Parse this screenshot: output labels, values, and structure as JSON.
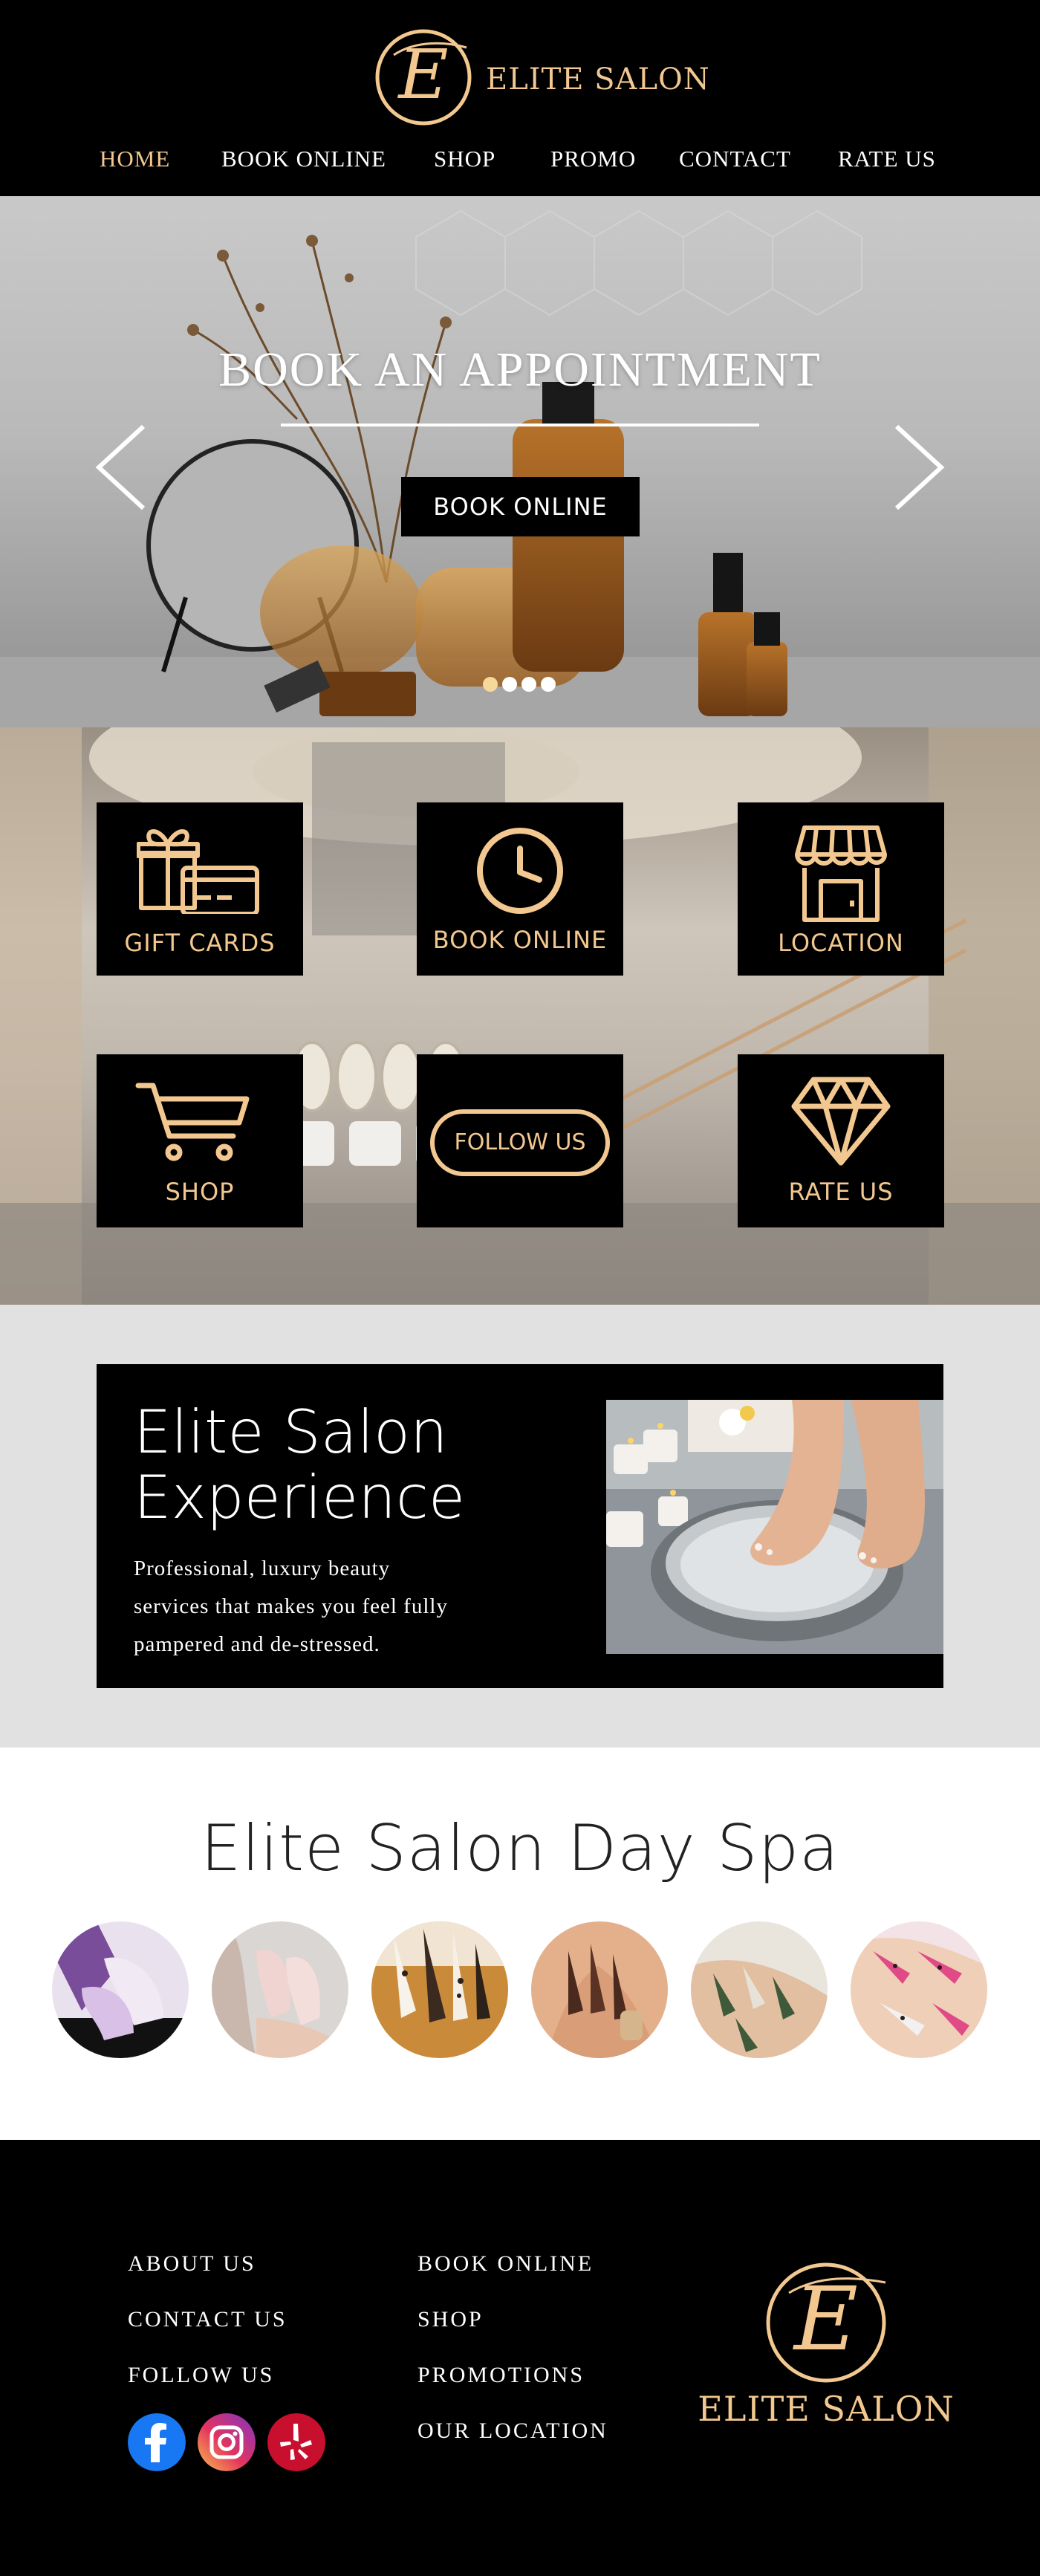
{
  "brand": {
    "name": "ELITE SALON",
    "monogram": "E"
  },
  "nav": {
    "items": [
      "HOME",
      "BOOK ONLINE",
      "SHOP",
      "PROMO",
      "CONTACT",
      "RATE US"
    ],
    "active": "HOME"
  },
  "hero": {
    "title": "BOOK AN APPOINTMENT",
    "button_label": "BOOK ONLINE",
    "slide_count": 4,
    "active_slide": 1
  },
  "tiles": {
    "gift_cards": "GIFT CARDS",
    "book_online": "BOOK ONLINE",
    "location": "LOCATION",
    "shop": "SHOP",
    "follow_us": "FOLLOW US",
    "rate_us": "RATE US"
  },
  "experience": {
    "title_line1": "Elite Salon",
    "title_line2": "Experience",
    "desc_line1": "Professional, luxury beauty",
    "desc_line2": "services that makes you feel fully",
    "desc_line3": "pampered and de-stressed."
  },
  "dayspa": {
    "title": "Elite Salon Day Spa"
  },
  "footer": {
    "about_us": "ABOUT US",
    "contact_us": "CONTACT US",
    "follow_us": "FOLLOW US",
    "book_online": "BOOK ONLINE",
    "shop": "SHOP",
    "promotions": "PROMOTIONS",
    "our_location": "OUR LOCATION",
    "brand": "ELITE SALON",
    "social": [
      "facebook-icon",
      "instagram-icon",
      "yelp-icon"
    ]
  },
  "colors": {
    "gold": "#f3c890",
    "black": "#000000",
    "white": "#ffffff",
    "light_gray": "#e1e1e1"
  }
}
